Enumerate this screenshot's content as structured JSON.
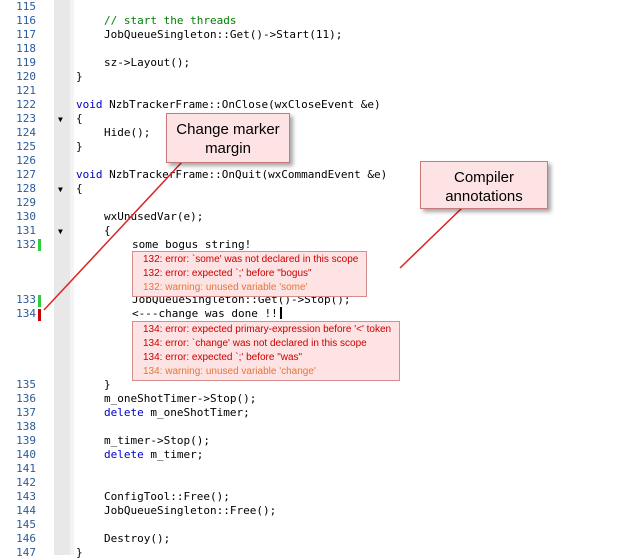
{
  "editor": {
    "lines": [
      {
        "num": "115",
        "code": ""
      },
      {
        "num": "116",
        "code": "// start the threads"
      },
      {
        "num": "117",
        "code": "JobQueueSingleton::Get()->Start(11);"
      },
      {
        "num": "118",
        "code": ""
      },
      {
        "num": "119",
        "code": "sz->Layout();"
      },
      {
        "num": "120",
        "code": "}"
      },
      {
        "num": "121",
        "code": ""
      },
      {
        "num": "122",
        "code": "void NzbTrackerFrame::OnClose(wxCloseEvent &e)"
      },
      {
        "num": "123",
        "code": "{"
      },
      {
        "num": "124",
        "code": "Hide();"
      },
      {
        "num": "125",
        "code": "}"
      },
      {
        "num": "126",
        "code": ""
      },
      {
        "num": "127",
        "code": "void NzbTrackerFrame::OnQuit(wxCommandEvent &e)"
      },
      {
        "num": "128",
        "code": "{"
      },
      {
        "num": "129",
        "code": ""
      },
      {
        "num": "130",
        "code": "wxUnusedVar(e);"
      },
      {
        "num": "131",
        "code": "{"
      },
      {
        "num": "132",
        "code": "some bogus string!"
      },
      {
        "num": "133",
        "code": "JobQueueSingleton::Get()->Stop();"
      },
      {
        "num": "134",
        "code": "<---change was done !!"
      },
      {
        "num": "135",
        "code": "}"
      },
      {
        "num": "136",
        "code": "m_oneShotTimer->Stop();"
      },
      {
        "num": "137",
        "code": "delete m_oneShotTimer;"
      },
      {
        "num": "138",
        "code": ""
      },
      {
        "num": "139",
        "code": "m_timer->Stop();"
      },
      {
        "num": "140",
        "code": "delete m_timer;"
      },
      {
        "num": "141",
        "code": ""
      },
      {
        "num": "142",
        "code": ""
      },
      {
        "num": "143",
        "code": "ConfigTool::Free();"
      },
      {
        "num": "144",
        "code": "JobQueueSingleton::Free();"
      },
      {
        "num": "145",
        "code": ""
      },
      {
        "num": "146",
        "code": "Destroy();"
      },
      {
        "num": "147",
        "code": "}"
      }
    ],
    "keywords": {
      "void": "void",
      "delete": "delete"
    },
    "annotations_132": [
      {
        "text": "132: error: `some' was not declared in this scope",
        "kind": "error"
      },
      {
        "text": "132: error: expected `;' before \"bogus\"",
        "kind": "error"
      },
      {
        "text": "132: warning: unused variable 'some'",
        "kind": "warning"
      }
    ],
    "annotations_134": [
      {
        "text": "134: error: expected primary-expression before '<' token",
        "kind": "error"
      },
      {
        "text": "134: error: `change' was not declared in this scope",
        "kind": "error"
      },
      {
        "text": "134: error: expected `;' before \"was\"",
        "kind": "error"
      },
      {
        "text": "134: warning: unused variable 'change'",
        "kind": "warning"
      }
    ]
  },
  "callouts": {
    "change_marker_margin": "Change marker margin",
    "compiler_annotations": "Compiler annotations"
  },
  "colors": {
    "error": "#cc0000",
    "warning": "#e0783b",
    "annotation_bg": "#fde3e3",
    "saved_change": "#2ecc40",
    "unsaved_change": "#cc0000",
    "line_number": "#2b5a9b",
    "keyword": "#0000c8",
    "comment": "#008000"
  }
}
